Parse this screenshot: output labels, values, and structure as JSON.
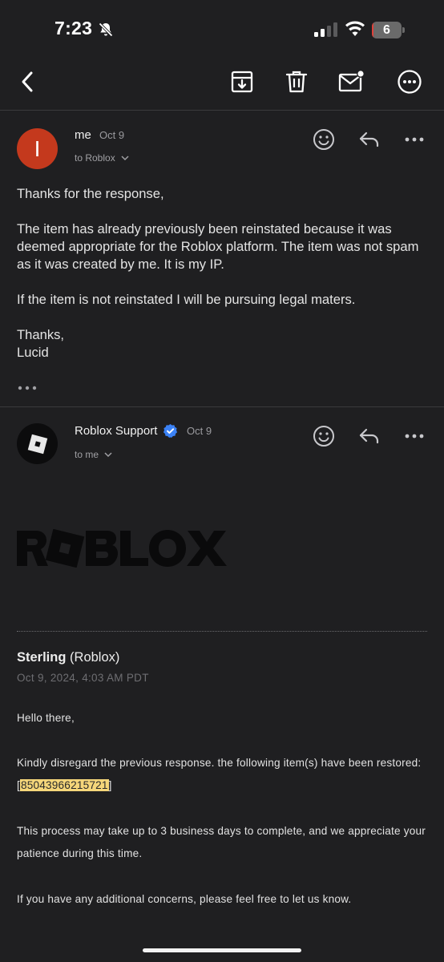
{
  "status_bar": {
    "time": "7:23",
    "battery_level": "6",
    "battery_fraction": 0.06,
    "battery_color": "#e0413a"
  },
  "toolbar": {
    "back_icon": "chevron-left-icon",
    "archive_icon": "archive-icon",
    "delete_icon": "trash-icon",
    "mark_unread_icon": "mail-unread-icon",
    "more_icon": "more-circle-icon"
  },
  "message_1": {
    "avatar_letter": "I",
    "avatar_color": "#c4391d",
    "sender": "me",
    "date": "Oct 9",
    "recipient": "to Roblox",
    "body": {
      "greeting": "Thanks for the response,",
      "paragraph_1": "The item has already previously been reinstated because it was deemed appropriate for the Roblox platform. The item was not spam as it was created by me. It is my IP.",
      "paragraph_2": "If the item is not reinstated I will be pursuing legal maters.",
      "signoff": "Thanks,",
      "name": "Lucid"
    }
  },
  "message_2": {
    "sender": "Roblox Support",
    "verified_color": "#3b82f6",
    "date": "Oct 9",
    "recipient": "to me",
    "logo_text": "ROBLOX",
    "agent_name": "Sterling",
    "agent_org": "(Roblox)",
    "timestamp": "Oct 9, 2024, 4:03 AM PDT",
    "greeting": "Hello there,",
    "restored_prefix": "Kindly disregard the previous response. the following item(s) have been restored: [",
    "item_id": "85043966215721",
    "restored_suffix": "]",
    "paragraph_2": "This process may take up to 3 business days to complete, and we appreciate your patience during this time.",
    "paragraph_3": "If you have any additional concerns, please feel free to let us know."
  },
  "colors": {
    "background": "#1f1f21",
    "highlight": "#f5d67a"
  }
}
